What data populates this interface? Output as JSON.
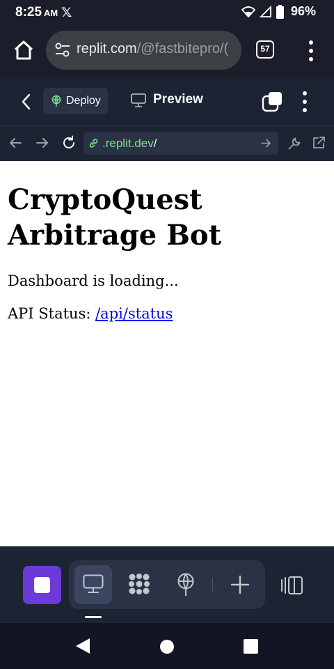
{
  "status_bar": {
    "time": "8:25",
    "ampm": "AM",
    "notification_icon": "x-logo",
    "icons": [
      "wifi-icon",
      "signal-icon",
      "battery-icon"
    ],
    "battery": "96%"
  },
  "browser": {
    "url_host": "replit.com",
    "url_path": "/@fastbitepro/(",
    "tab_count": "57",
    "icons": [
      "home-icon",
      "site-settings-icon",
      "more-vert-icon"
    ]
  },
  "replit_header": {
    "deploy_label": "Deploy",
    "preview_label": "Preview",
    "icons": [
      "chevron-left-icon",
      "deploy-icon",
      "monitor-icon",
      "windows-icon",
      "more-vert-icon"
    ]
  },
  "preview_url": {
    "host": ".replit.dev",
    "path": "/",
    "icons": [
      "arrow-back-icon",
      "arrow-forward-icon",
      "reload-icon",
      "link-icon",
      "go-icon",
      "wrench-icon",
      "open-external-icon"
    ]
  },
  "page": {
    "heading": "CryptoQuest Arbitrage Bot",
    "loading_text": "Dashboard is loading...",
    "api_label": "API Status: ",
    "api_link": "/api/status"
  },
  "dock": {
    "tools": [
      "stop-icon",
      "webview-icon",
      "workflows-icon",
      "deploy-icon",
      "plus-icon",
      "split-view-icon"
    ],
    "colors": {
      "stop": "#6b3ad8",
      "dock_bg": "#1c2333",
      "group_bg": "#2b3245"
    }
  },
  "colors": {
    "url_green": "#7ee08f",
    "link_blue": "#0000ee",
    "header_bg": "#1c2333",
    "chrome_bg": "#1b1e2a"
  }
}
